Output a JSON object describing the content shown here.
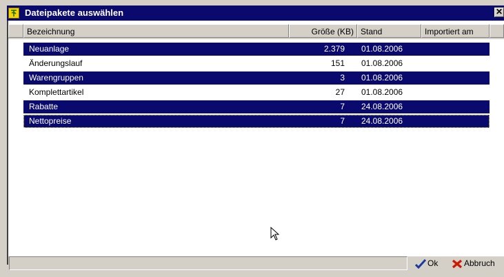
{
  "window": {
    "title": "Dateipakete auswählen",
    "close_label": "✕"
  },
  "columns": {
    "name": "Bezeichnung",
    "size": "Größe (KB)",
    "date": "Stand",
    "imported": "Importiert am"
  },
  "rows": [
    {
      "name": "Neuanlage",
      "size": "2.379",
      "date": "01.08.2006",
      "selected": true
    },
    {
      "name": "Änderungslauf",
      "size": "151",
      "date": "01.08.2006",
      "selected": false
    },
    {
      "name": "Warengruppen",
      "size": "3",
      "date": "01.08.2006",
      "selected": true
    },
    {
      "name": "Komplettartikel",
      "size": "27",
      "date": "01.08.2006",
      "selected": false
    },
    {
      "name": "Rabatte",
      "size": "7",
      "date": "24.08.2006",
      "selected": true
    },
    {
      "name": "Nettopreise",
      "size": "7",
      "date": "24.08.2006",
      "selected": true
    }
  ],
  "buttons": {
    "ok": "Ok",
    "cancel": "Abbruch"
  },
  "colors": {
    "title_bg": "#0a0a6e",
    "selection": "#0a0a6e",
    "check": "#1a3a9e",
    "cross": "#cc1a00"
  },
  "icons": [
    "app-icon",
    "close-icon",
    "check-icon",
    "cross-icon",
    "mouse-pointer-icon"
  ]
}
